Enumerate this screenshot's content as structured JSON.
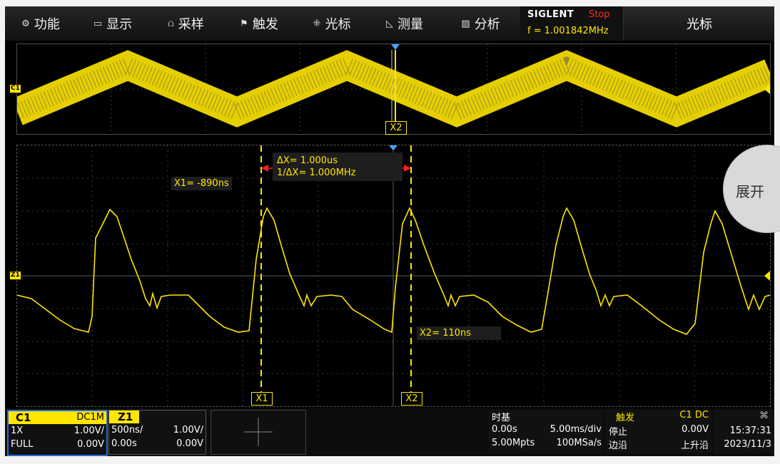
{
  "menu": [
    {
      "icon": "⚙",
      "label": "功能"
    },
    {
      "icon": "▭",
      "label": "显示"
    },
    {
      "icon": "⩍",
      "label": "采样"
    },
    {
      "icon": "⚑",
      "label": "触发"
    },
    {
      "icon": "⁜",
      "label": "光标"
    },
    {
      "icon": "◺",
      "label": "测量"
    },
    {
      "icon": "▨",
      "label": "分析"
    }
  ],
  "brand": {
    "logo": "SIGLENT",
    "state": "Stop",
    "freq": "f = 1.001842MHz"
  },
  "right_title": "光标",
  "overview": {
    "channel_marker": "C1",
    "cursor_tag": "X2"
  },
  "zoom": {
    "channel_marker": "Z1",
    "x1_readout": "X1= -890ns",
    "x2_readout": "X2= 110ns",
    "delta_x": "ΔX= 1.000us",
    "inv_delta_x": "1/ΔX= 1.000MHz",
    "x1_tag": "X1",
    "x2_tag": "X2"
  },
  "expand_label": "展开",
  "c1": {
    "name": "C1",
    "coupling": "DC1M",
    "probe": "1X",
    "vdiv": "1.00V/",
    "bw": "FULL",
    "offset": "0.00V"
  },
  "z1": {
    "name": "Z1",
    "hdiv": "500ns/",
    "vdiv": "1.00V/",
    "delay": "0.00s",
    "offset": "0.00V"
  },
  "timebase": {
    "title": "时基",
    "delay": "0.00s",
    "tdiv": "5.00ms/div",
    "points": "5.00Mpts",
    "rate": "100MSa/s"
  },
  "trigger": {
    "title": "触发",
    "source": "C1 DC",
    "state": "停止",
    "level": "0.00V",
    "type": "边沿",
    "slope": "上升沿"
  },
  "clock": {
    "time": "15:37:31",
    "date": "2023/11/3"
  },
  "colors": {
    "trace": "#ffe600",
    "accent": "#2a6cd0",
    "stop": "#ff2a2a"
  }
}
